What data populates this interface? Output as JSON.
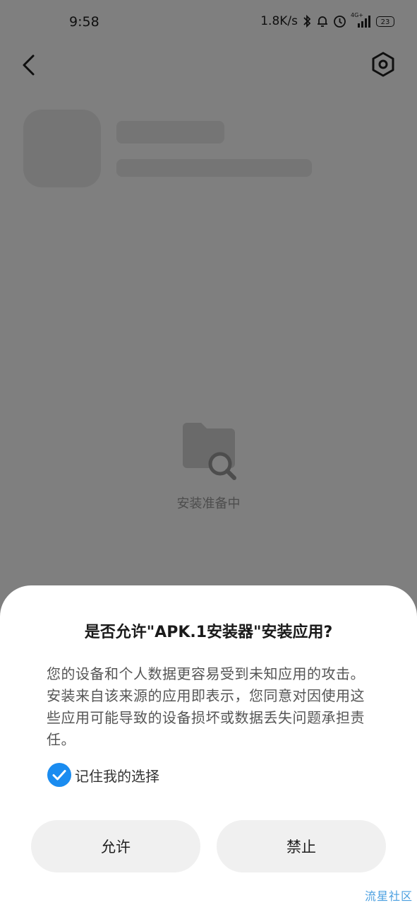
{
  "status_bar": {
    "time": "9:58",
    "net_speed": "1.8K/s",
    "network_type": "4G+",
    "battery": "23",
    "icons": [
      "bluetooth-icon",
      "alarm-bell-icon",
      "clock-icon",
      "signal-icon",
      "battery-icon"
    ]
  },
  "top_bar": {
    "back_icon": "back-arrow-icon",
    "settings_icon": "settings-hexagon-icon"
  },
  "loading": {
    "icon": "folder-search-icon",
    "text": "安装准备中"
  },
  "dialog": {
    "title": "是否允许\"APK.1安装器\"安装应用?",
    "message": "您的设备和个人数据更容易受到未知应用的攻击。安装来自该来源的应用即表示，您同意对因使用这些应用可能导致的设备损坏或数据丢失问题承担责任。",
    "remember_label": "记住我的选择",
    "remember_checked": true,
    "allow_label": "允许",
    "deny_label": "禁止"
  },
  "watermark": "流星社区",
  "colors": {
    "accent": "#1a8cf0",
    "scrim": "#808080",
    "button_bg": "#f0f0f0"
  }
}
